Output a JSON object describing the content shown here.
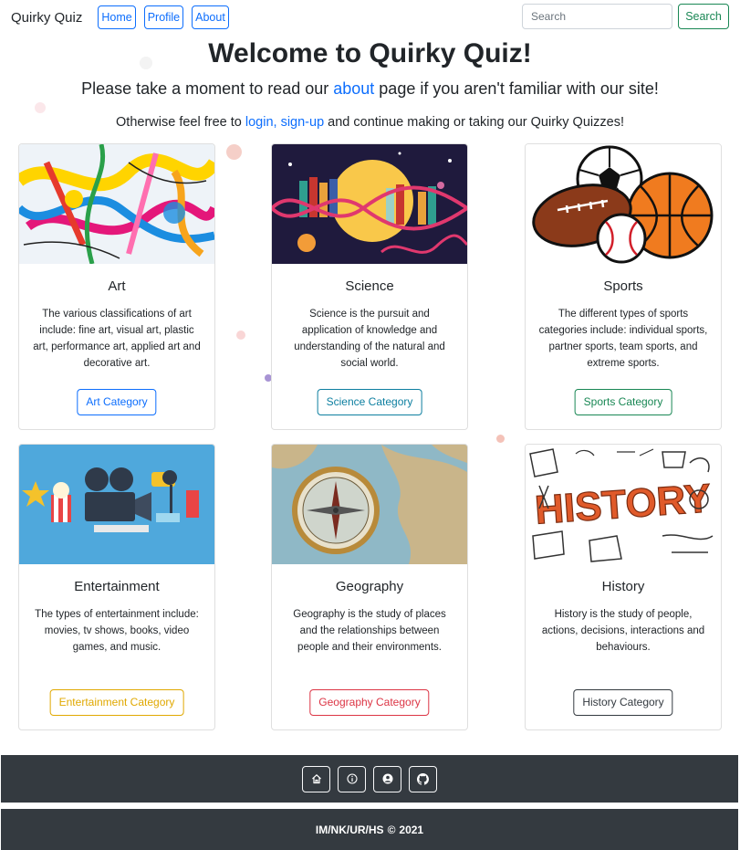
{
  "navbar": {
    "brand": "Quirky Quiz",
    "links": [
      "Home",
      "Profile",
      "About"
    ],
    "search_placeholder": "Search",
    "search_button": "Search"
  },
  "hero": {
    "title": "Welcome to Quirky Quiz!",
    "line1_before": "Please take a moment to read our ",
    "line1_link": "about",
    "line1_after": " page if you aren't familiar with our site!",
    "line2_before": "Otherwise feel free to ",
    "line2_link_login": "login",
    "line2_sep": ", ",
    "line2_link_signup": "sign-up",
    "line2_after": " and continue making or taking our Quirky Quizzes!"
  },
  "cards": [
    {
      "title": "Art",
      "text": "The various classifications of art include: fine art, visual art, plastic art, performance art, applied art and decorative art.",
      "button": "Art Category",
      "button_color": "#0d6efd",
      "image": "art-image"
    },
    {
      "title": "Science",
      "text": "Science is the pursuit and application of knowledge and understanding of the natural and social world.",
      "button": "Science Category",
      "button_color": "#0d7fa0",
      "image": "science-image"
    },
    {
      "title": "Sports",
      "text": "The different types of sports categories include: individual sports, partner sports, team sports, and extreme sports.",
      "button": "Sports Category",
      "button_color": "#198754",
      "image": "sports-balls-image"
    },
    {
      "title": "Entertainment",
      "text": "The types of entertainment include: movies, tv shows, books, video games, and music.",
      "button": "Entertainment Category",
      "button_color": "#e0a800",
      "image": "entertainment-image"
    },
    {
      "title": "Geography",
      "text": "Geography is the study of places and the relationships between people and their environments.",
      "button": "Geography Category",
      "button_color": "#dc3545",
      "image": "compass-map-image"
    },
    {
      "title": "History",
      "text": "History is the study of people, actions, decisions, interactions and behaviours.",
      "button": "History Category",
      "button_color": "#343a40",
      "image": "history-doodle-image"
    }
  ],
  "footer": {
    "icons": [
      "home-icon",
      "info-icon",
      "user-icon",
      "github-icon"
    ],
    "copyright_before": "IM/NK/UR/HS",
    "copyright_symbol": "©",
    "copyright_year": "2021"
  }
}
